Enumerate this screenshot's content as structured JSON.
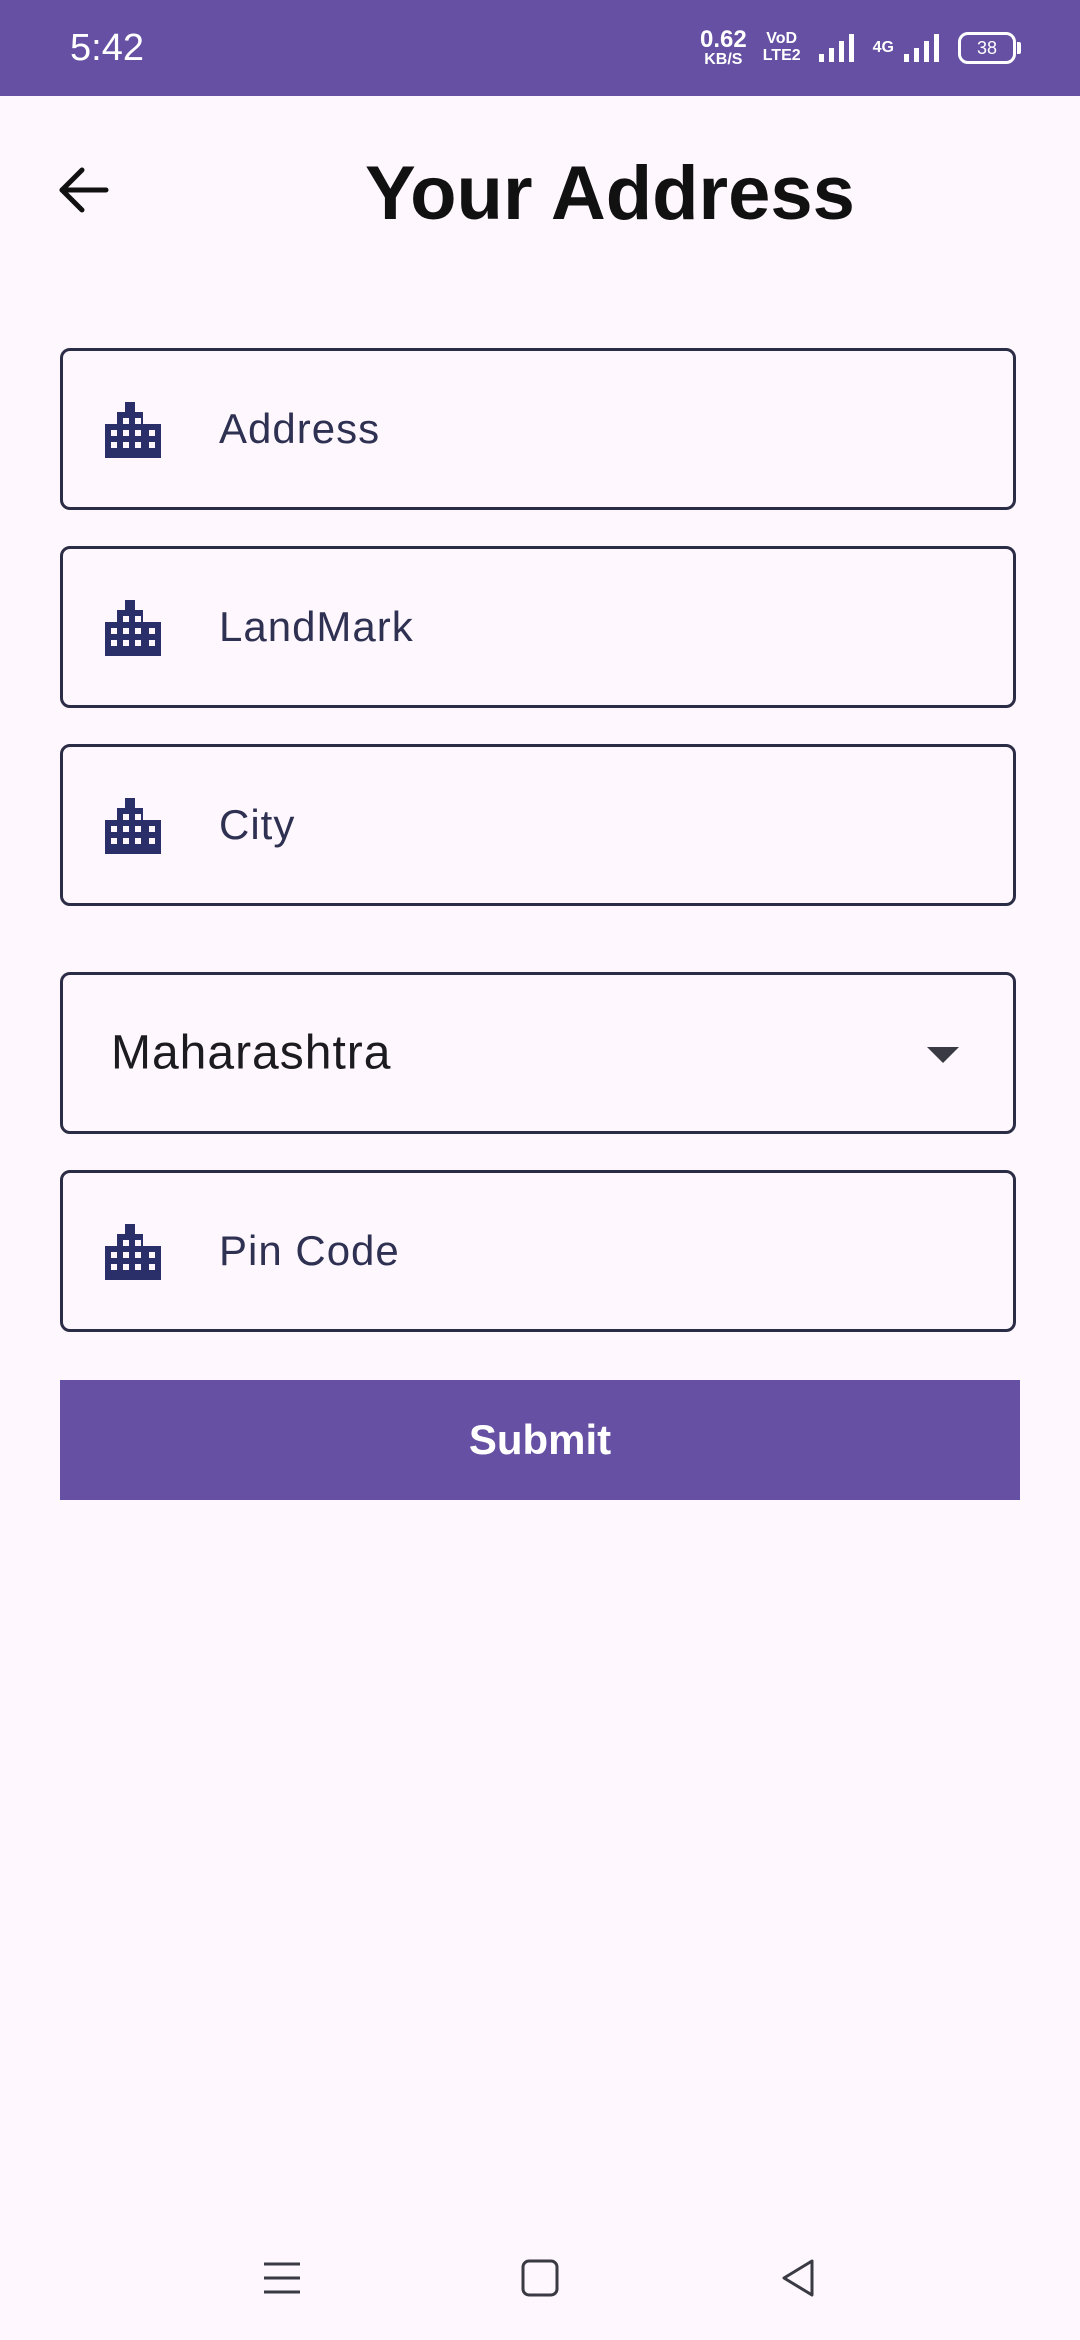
{
  "status_bar": {
    "time": "5:42",
    "net_speed_value": "0.62",
    "net_speed_unit": "KB/S",
    "volte_top": "VoD",
    "volte_bottom": "LTE2",
    "network_type": "4G",
    "battery": "38",
    "background_color": "#6650a4"
  },
  "header": {
    "title": "Your Address",
    "back_icon": "arrow-left-icon"
  },
  "form": {
    "address": {
      "placeholder": "Address",
      "icon": "building-icon"
    },
    "landmark": {
      "placeholder": "LandMark",
      "icon": "building-icon"
    },
    "city": {
      "placeholder": "City",
      "icon": "building-icon"
    },
    "state": {
      "selected": "Maharashtra",
      "icon": "dropdown-caret-icon"
    },
    "pin_code": {
      "placeholder": "Pin Code",
      "icon": "building-icon"
    }
  },
  "submit": {
    "label": "Submit",
    "color": "#6650a4"
  },
  "nav_bar": {
    "menu_icon": "menu-icon",
    "home_icon": "home-square-icon",
    "back_icon": "back-triangle-icon"
  }
}
